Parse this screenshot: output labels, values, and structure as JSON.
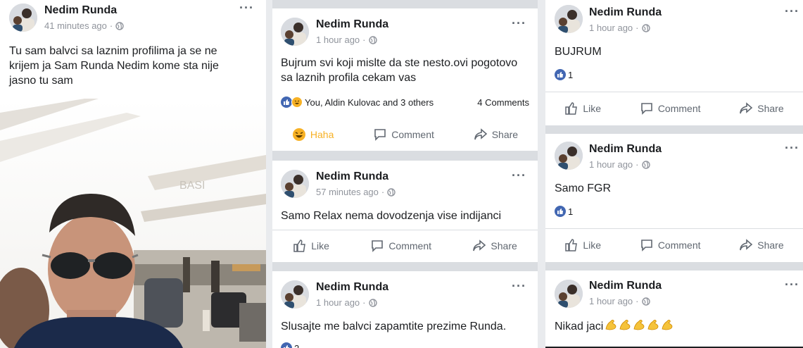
{
  "left": {
    "author": "Nedim Runda",
    "time": "41 minutes ago",
    "text": "Tu sam balvci sa laznim profilima ja se ne krijem ja Sam Runda Nedim kome sta nije jasno tu sam",
    "photo_sign": "BASI"
  },
  "middle": {
    "post1": {
      "author": "Nedim Runda",
      "time": "1 hour ago",
      "text": "Bujrum svi koji mislte da ste nesto.ovi pogotovo sa laznih profila cekam vas",
      "reactions": "You, Aldin Kulovac and 3 others",
      "comments": "4 Comments",
      "btn_react": "Haha",
      "btn_comment": "Comment",
      "btn_share": "Share"
    },
    "post2": {
      "author": "Nedim Runda",
      "time": "57 minutes ago",
      "text": "Samo Relax nema dovodzenja vise indijanci",
      "btn_like": "Like",
      "btn_comment": "Comment",
      "btn_share": "Share"
    },
    "post3": {
      "author": "Nedim Runda",
      "time": "1 hour ago",
      "text": "Slusajte me balvci zapamtite prezime Runda.",
      "reaction_count": "2"
    }
  },
  "right": {
    "post1": {
      "author": "Nedim Runda",
      "time": "1 hour ago",
      "text": "BUJRUM",
      "reaction_count": "1",
      "btn_like": "Like",
      "btn_comment": "Comment",
      "btn_share": "Share"
    },
    "post2": {
      "author": "Nedim Runda",
      "time": "1 hour ago",
      "text": "Samo FGR",
      "reaction_count": "1",
      "btn_like": "Like",
      "btn_comment": "Comment",
      "btn_share": "Share"
    },
    "post3": {
      "author": "Nedim Runda",
      "time": "1 hour ago",
      "text": "Nikad jaci"
    }
  },
  "icons": {
    "globe": "globe-icon",
    "more": "more-options-icon",
    "like": "like-icon",
    "comment": "comment-icon",
    "share": "share-icon",
    "haha": "haha-icon",
    "muscle": "flexed-biceps-icon"
  },
  "colors": {
    "brand_blue": "#4267b2",
    "haha_yellow": "#f7b125",
    "secondary_text": "#90949c",
    "action_gray": "#606770"
  }
}
